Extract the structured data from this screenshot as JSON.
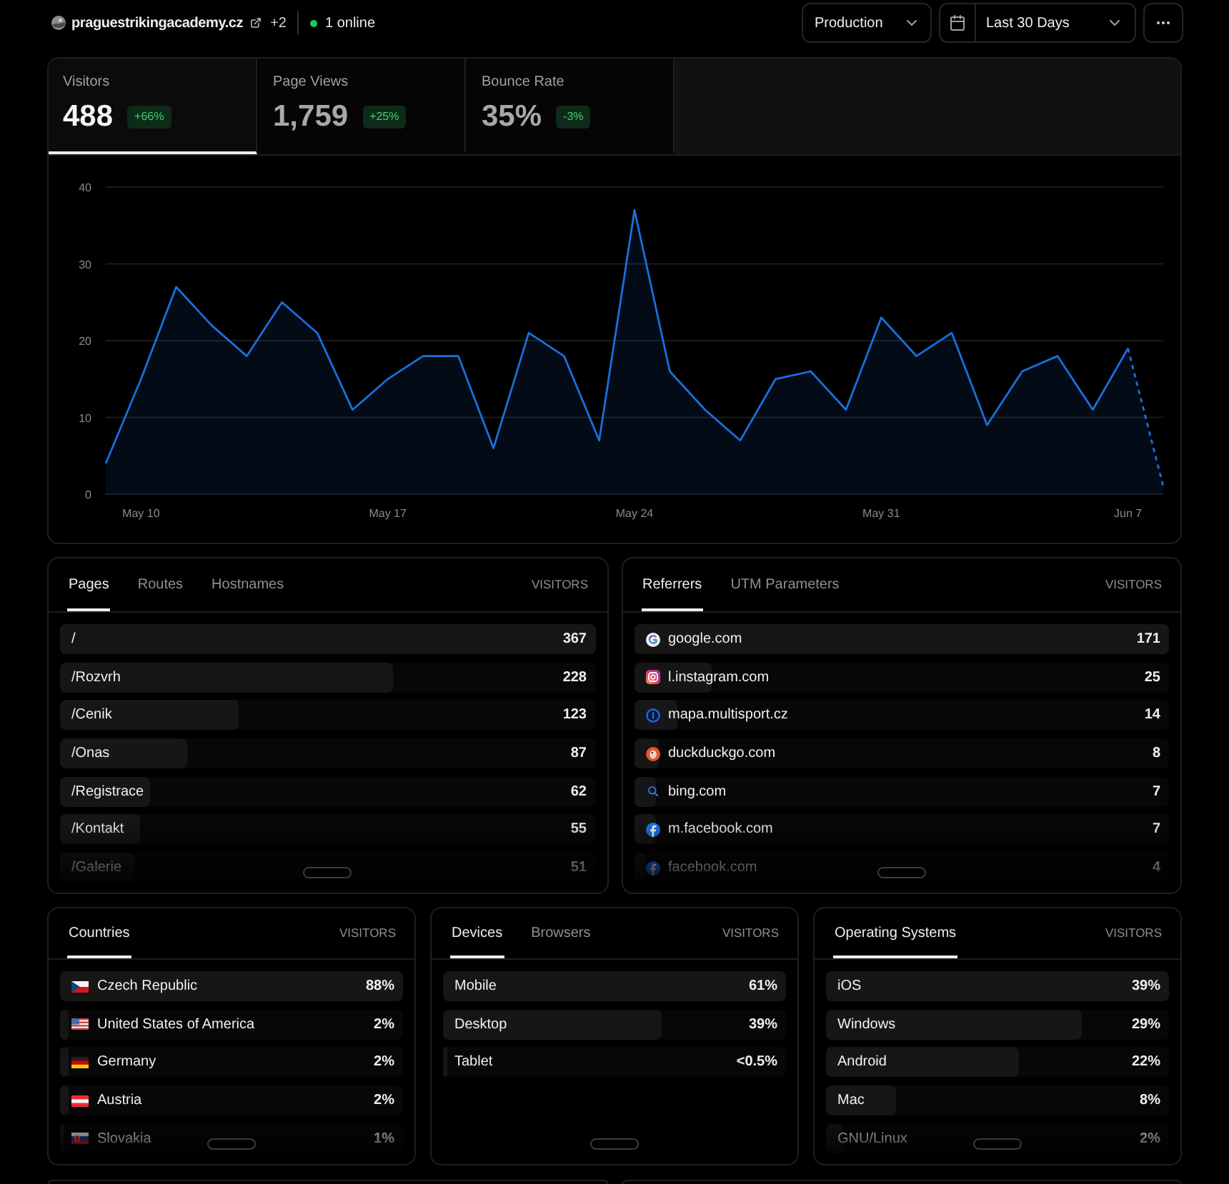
{
  "header": {
    "site": {
      "name": "praguestrikingacademy.cz",
      "extra": "+2"
    },
    "online": "1 online",
    "environment": "Production",
    "period": "Last 30 Days"
  },
  "stats": {
    "tabs": [
      {
        "label": "Visitors",
        "value": "488",
        "change": "+66%",
        "selected": true
      },
      {
        "label": "Page Views",
        "value": "1,759",
        "change": "+25%",
        "selected": false
      },
      {
        "label": "Bounce Rate",
        "value": "35%",
        "change": "-3%",
        "selected": false
      }
    ],
    "chart_data": {
      "type": "area",
      "categories": [
        null,
        "May 10",
        null,
        null,
        null,
        null,
        null,
        null,
        "May 17",
        null,
        null,
        null,
        null,
        null,
        null,
        "May 24",
        null,
        null,
        null,
        null,
        null,
        null,
        "May 31",
        null,
        null,
        null,
        null,
        null,
        null,
        "Jun 7",
        null
      ],
      "series": [
        {
          "color": "#1a6fdb",
          "values": [
            4,
            15,
            27,
            22,
            18,
            25,
            21,
            11,
            15,
            18,
            18,
            6,
            21,
            18,
            7,
            37,
            16,
            11,
            7,
            15,
            16,
            11,
            23,
            18,
            21,
            9,
            16,
            18,
            11,
            19,
            1
          ]
        }
      ],
      "ylim": [
        0,
        40
      ],
      "yticks": [
        0,
        10,
        20,
        30,
        40
      ],
      "grid": true
    }
  },
  "panel_rows": [
    {
      "panels": [
        {
          "tabs": [
            {
              "label": "Pages",
              "selected": true
            },
            {
              "label": "Routes",
              "selected": false
            },
            {
              "label": "Hostnames",
              "selected": false
            }
          ],
          "column": "VISITORS",
          "rows": [
            {
              "label": "/",
              "value": "367",
              "level": 1
            },
            {
              "label": "/Rozvrh",
              "value": "228",
              "level": 0.621
            },
            {
              "label": "/Cenik",
              "value": "123",
              "level": 0.335
            },
            {
              "label": "/Onas",
              "value": "87",
              "level": 0.237
            },
            {
              "label": "/Registrace",
              "value": "62",
              "level": 0.169
            },
            {
              "label": "/Kontakt",
              "value": "55",
              "level": 0.15
            },
            {
              "label": "/Galerie",
              "value": "51",
              "level": 0.139
            }
          ]
        },
        {
          "tabs": [
            {
              "label": "Referrers",
              "selected": true
            },
            {
              "label": "UTM Parameters",
              "selected": false
            }
          ],
          "column": "VISITORS",
          "rows": [
            {
              "kind": "google",
              "label": "google.com",
              "value": "171",
              "level": 1
            },
            {
              "kind": "instagram",
              "label": "l.instagram.com",
              "value": "25",
              "level": 0.146
            },
            {
              "kind": "multisport",
              "label": "mapa.multisport.cz",
              "value": "14",
              "level": 0.082
            },
            {
              "kind": "duckduckgo",
              "label": "duckduckgo.com",
              "value": "8",
              "level": 0.047
            },
            {
              "kind": "bing",
              "label": "bing.com",
              "value": "7",
              "level": 0.041
            },
            {
              "kind": "facebook",
              "label": "m.facebook.com",
              "value": "7",
              "level": 0.041
            },
            {
              "kind": "facebook",
              "label": "facebook.com",
              "value": "4",
              "level": 0.023
            }
          ]
        }
      ]
    },
    {
      "panels": [
        {
          "tabs": [
            {
              "label": "Countries",
              "selected": true
            }
          ],
          "column": "VISITORS",
          "rows": [
            {
              "kind": "czech",
              "label": "Czech Republic",
              "value": "88%",
              "level": 1
            },
            {
              "kind": "usa",
              "label": "United States of America",
              "value": "2%",
              "level": 0.023
            },
            {
              "kind": "germany",
              "label": "Germany",
              "value": "2%",
              "level": 0.023
            },
            {
              "kind": "austria",
              "label": "Austria",
              "value": "2%",
              "level": 0.023
            },
            {
              "kind": "slovakia",
              "label": "Slovakia",
              "value": "1%",
              "level": 0.011
            }
          ]
        },
        {
          "tabs": [
            {
              "label": "Devices",
              "selected": true
            },
            {
              "label": "Browsers",
              "selected": false
            }
          ],
          "column": "VISITORS",
          "rows": [
            {
              "label": "Mobile",
              "value": "61%",
              "level": 1
            },
            {
              "label": "Desktop",
              "value": "39%",
              "level": 0.639
            },
            {
              "label": "Tablet",
              "value": "<0.5%",
              "level": 0.012
            }
          ]
        },
        {
          "tabs": [
            {
              "label": "Operating Systems",
              "selected": true
            }
          ],
          "column": "VISITORS",
          "rows": [
            {
              "label": "iOS",
              "value": "39%",
              "level": 1
            },
            {
              "label": "Windows",
              "value": "29%",
              "level": 0.744
            },
            {
              "label": "Android",
              "value": "22%",
              "level": 0.564
            },
            {
              "label": "Mac",
              "value": "8%",
              "level": 0.205
            },
            {
              "label": "GNU/Linux",
              "value": "2%",
              "level": 0.051
            }
          ]
        }
      ]
    }
  ]
}
